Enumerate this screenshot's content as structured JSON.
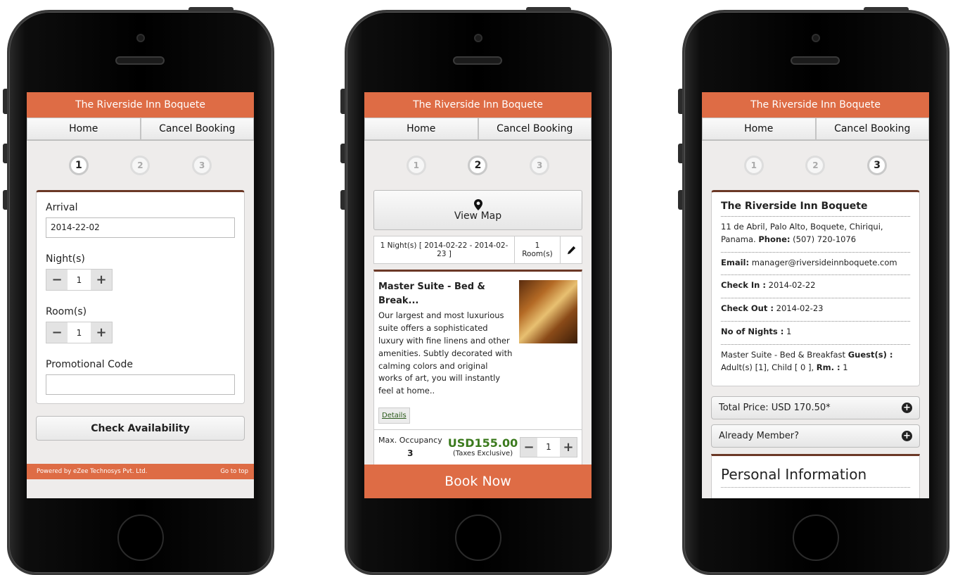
{
  "app": {
    "title": "The Riverside Inn Boquete",
    "nav_home": "Home",
    "nav_cancel": "Cancel Booking",
    "steps": [
      "1",
      "2",
      "3"
    ]
  },
  "screen1": {
    "arrival_label": "Arrival",
    "arrival_value": "2014-22-02",
    "nights_label": "Night(s)",
    "nights_value": "1",
    "rooms_label": "Room(s)",
    "rooms_value": "1",
    "promo_label": "Promotional Code",
    "promo_value": "",
    "check_button": "Check Availability",
    "footer_left": "Powered by eZee Technosys Pvt. Ltd.",
    "footer_right": "Go to top"
  },
  "screen2": {
    "view_map": "View Map",
    "stay_info": "1 Night(s) [ 2014-02-22 - 2014-02-23 ]",
    "rooms_info": "1 Room(s)",
    "room_title": "Master Suite - Bed & Break...",
    "room_desc": "Our largest and most luxurious suite offers a sophisticated luxury with fine linens and other amenities. Subtly decorated with calming colors and original works of art, you will instantly feel at home..",
    "details_link": "Details",
    "max_occupancy_label": "Max. Occupancy",
    "max_occupancy_value": "3",
    "price": "USD155.00",
    "tax_note": "(Taxes Exclusive)",
    "qty_value": "1",
    "book_now": "Book Now"
  },
  "screen3": {
    "hotel_name": "The Riverside Inn Boquete",
    "address": "11 de Abril, Palo Alto, Boquete, Chiriqui, Panama.",
    "phone_label": "Phone:",
    "phone_value": "(507) 720-1076",
    "email_label": "Email:",
    "email_value": "manager@riversideinnboquete.com",
    "checkin_label": "Check In :",
    "checkin_value": "2014-02-22",
    "checkout_label": "Check Out :",
    "checkout_value": "2014-02-23",
    "nights_label": "No of Nights :",
    "nights_value": "1",
    "room_name": "Master Suite - Bed & Breakfast",
    "guests_label": "Guest(s) :",
    "guests_value": "Adult(s) [1], Child [ 0 ],",
    "rm_label": "Rm. :",
    "rm_value": "1",
    "total_price": "Total Price: USD 170.50*",
    "already_member": "Already Member?",
    "personal_info": "Personal Information"
  },
  "colors": {
    "brand": "#de6c45",
    "card_border": "#6b3826",
    "price": "#3b7a1d"
  },
  "icons": {
    "map": "map-marker-icon",
    "edit": "pencil-icon",
    "expand": "plus-circle-icon"
  }
}
